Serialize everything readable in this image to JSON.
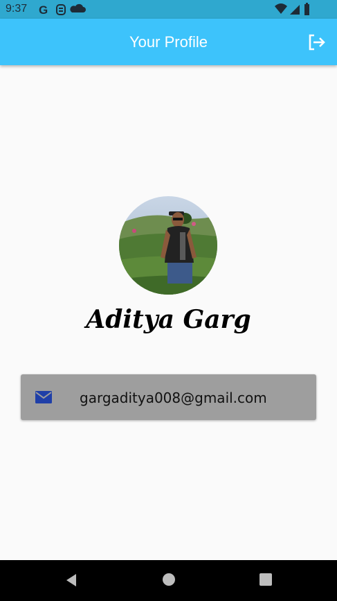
{
  "status_bar": {
    "time": "9:37",
    "left_icons": [
      "google-icon",
      "notification-icon",
      "cloud-icon"
    ],
    "right_icons": [
      "wifi-icon",
      "signal-icon",
      "battery-icon"
    ]
  },
  "app_bar": {
    "title": "Your Profile",
    "action_icon": "logout-icon"
  },
  "profile": {
    "avatar": "profile-photo",
    "name": "Aditya Garg",
    "email": "gargaditya008@gmail.com",
    "email_icon": "mail-icon"
  },
  "nav_bar": {
    "buttons": [
      "back-icon",
      "home-icon",
      "recents-icon"
    ]
  },
  "colors": {
    "status_bar": "#2fa8cf",
    "app_bar": "#3dc3fb",
    "background": "#fafafa",
    "email_card": "#9e9e9e",
    "mail_icon": "#1f3fa8"
  }
}
